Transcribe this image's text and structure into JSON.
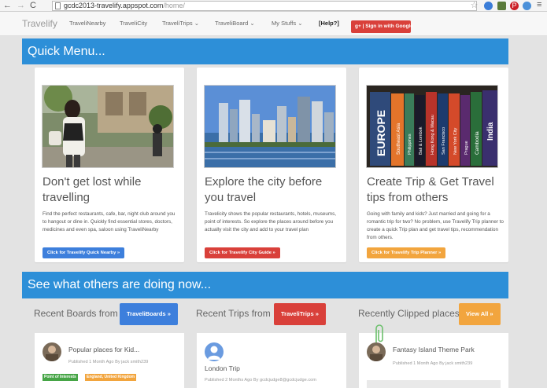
{
  "browser": {
    "url_host": "gcdc2013-travelify.appspot.com",
    "url_path": "/home/"
  },
  "nav": {
    "brand": "Travelify",
    "items": [
      "TraveliNearby",
      "TraveliCity",
      "TraveliTrips ⌄",
      "TraveliBoard ⌄",
      "My Stuffs ⌄",
      "[Help?]"
    ],
    "signin": "g+ | Sign in with Google"
  },
  "quick_menu": {
    "title": "Quick Menu...",
    "cards": [
      {
        "title": "Don't get lost while travelling",
        "desc": "Find the perfect restaurants, cafe, bar, night club around you to hangout or dine in. Quickly find essential stores, doctors, medicines and even spa, saloon using TraveliNearby",
        "button": "Click for Travelify Quick Nearby »",
        "button_color": "#3d7fdc"
      },
      {
        "title": "Explore the city before you travel",
        "desc": "Travelicity shows the popular restaurants, hotels, museums, point of interests. So explore the places around before you actually visit the city and add to your travel plan",
        "button": "Click for Travelify City Guide »",
        "button_color": "#d9403a"
      },
      {
        "title": "Create Trip & Get Travel tips from others",
        "desc": "Going with family and kids? Just married and going for a romantic trip for two? No problem, use Travelify Trip planner to create a quick Trip plan and get travel tips, recommendation from others.",
        "button": "Click for Travelify Trip Planner »",
        "button_color": "#f2a53e"
      }
    ],
    "book_spines": [
      "EUROPE",
      "Southeast Asia",
      "Philippines",
      "Bali & Lombok",
      "Hong Kong & Macau",
      "San Francisco",
      "New York City",
      "Prague",
      "Cambodia",
      "India"
    ]
  },
  "others": {
    "title": "See what others are doing now...",
    "boards_label": "Recent Boards from",
    "boards_button": "TraveliBoards »",
    "trips_label": "Recent Trips from",
    "trips_button": "TraveliTrips »",
    "clipped_label": "Recently Clipped places",
    "clipped_button": "View All »",
    "board": {
      "title": "Popular places for Kid...",
      "meta": "Published 1 Month Ago By jack smith239",
      "tags": [
        "Point of Interests",
        "England, United Kingdom"
      ]
    },
    "trip": {
      "title": "London Trip",
      "meta": "Published 2 Months Ago By gcdcjudge8@gcdcjudge.com"
    },
    "clipped": {
      "title": "Fantasy Island Theme Park",
      "meta": "Published 1 Month Ago By jack smith239"
    }
  }
}
